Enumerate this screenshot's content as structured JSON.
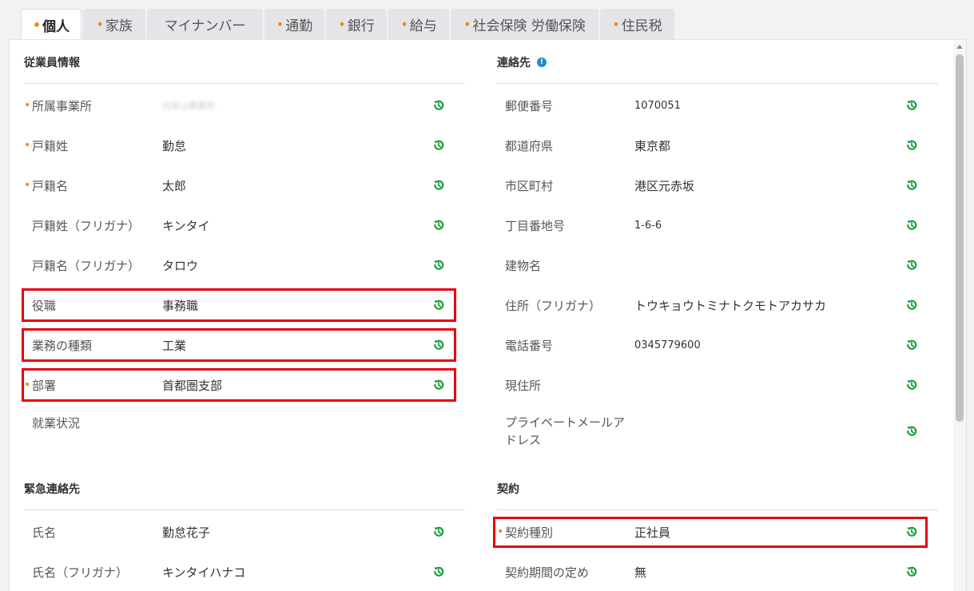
{
  "tabs": [
    {
      "label": "個人",
      "required": true,
      "active": true
    },
    {
      "label": "家族",
      "required": true
    },
    {
      "label": "マイナンバー",
      "required": false
    },
    {
      "label": "通勤",
      "required": true
    },
    {
      "label": "銀行",
      "required": true
    },
    {
      "label": "給与",
      "required": true
    },
    {
      "label": "社会保険 労働保険",
      "required": true
    },
    {
      "label": "住民税",
      "required": true
    }
  ],
  "employee": {
    "title": "従業員情報",
    "rows": [
      {
        "label": "所属事業所",
        "value": "代官山事業所",
        "required": true
      },
      {
        "label": "戸籍姓",
        "value": "勤怠",
        "required": true
      },
      {
        "label": "戸籍名",
        "value": "太郎",
        "required": true
      },
      {
        "label": "戸籍姓（フリガナ）",
        "value": "キンタイ",
        "required": false
      },
      {
        "label": "戸籍名（フリガナ）",
        "value": "タロウ",
        "required": false
      },
      {
        "label": "役職",
        "value": "事務職",
        "required": false
      },
      {
        "label": "業務の種類",
        "value": "工業",
        "required": false
      },
      {
        "label": "部署",
        "value": "首都圏支部",
        "required": true
      },
      {
        "label": "就業状況",
        "value": "",
        "required": false
      }
    ]
  },
  "emergency": {
    "title": "緊急連絡先",
    "rows": [
      {
        "label": "氏名",
        "value": "勤怠花子"
      },
      {
        "label": "氏名（フリガナ）",
        "value": "キンタイハナコ"
      }
    ]
  },
  "contact": {
    "title": "連絡先",
    "rows": [
      {
        "label": "郵便番号",
        "value": "1070051"
      },
      {
        "label": "都道府県",
        "value": "東京都"
      },
      {
        "label": "市区町村",
        "value": "港区元赤坂"
      },
      {
        "label": "丁目番地号",
        "value": "1-6-6"
      },
      {
        "label": "建物名",
        "value": ""
      },
      {
        "label": "住所（フリガナ）",
        "value": "トウキョウトミナトクモトアカサカ"
      },
      {
        "label": "電話番号",
        "value": "0345779600"
      },
      {
        "label": "現住所",
        "value": ""
      },
      {
        "label": "プライベートメールア",
        "label2": "ドレス",
        "value": ""
      }
    ]
  },
  "contract": {
    "title": "契約",
    "rows": [
      {
        "label": "契約種別",
        "value": "正社員",
        "required": true
      },
      {
        "label": "契約期間の定め",
        "value": "無"
      }
    ]
  },
  "colors": {
    "accent_required": "#f08a00",
    "history_icon": "#1e9e3e",
    "highlight": "#e60012",
    "info": "#1f8fc9"
  },
  "icons": {
    "history": "history-icon",
    "info": "info-icon",
    "required": "required-dot-icon"
  },
  "glyphs": {
    "required_dot": "•",
    "info": "!"
  }
}
